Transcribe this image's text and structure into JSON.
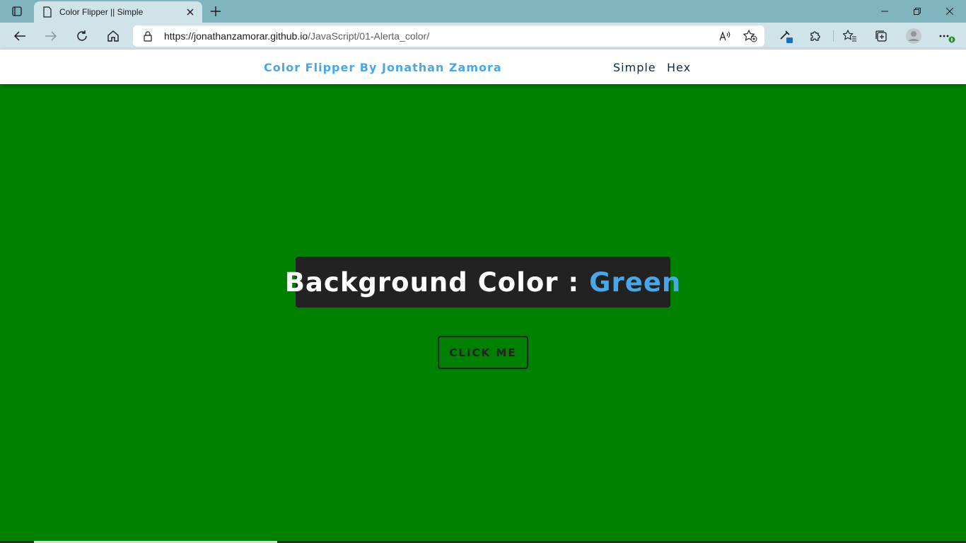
{
  "browser": {
    "tab": {
      "title": "Color Flipper || Simple"
    },
    "url": {
      "host": "https://jonathanzamorar.github.io",
      "path": "/JavaScript/01-Alerta_color/"
    }
  },
  "site": {
    "brand": "Color Flipper By Jonathan Zamora",
    "nav": [
      "Simple",
      "Hex"
    ]
  },
  "main": {
    "label": "Background Color :",
    "color_name": "Green",
    "button_label": "CLICK ME"
  },
  "colors": {
    "page_background": "#008000",
    "accent": "#49a6e9",
    "card": "#222222"
  },
  "icons": [
    "tab-actions-icon",
    "page-icon",
    "close-icon",
    "plus-icon",
    "minimize-icon",
    "restore-icon",
    "back-icon",
    "forward-icon",
    "refresh-icon",
    "home-icon",
    "lock-icon",
    "read-aloud-icon",
    "add-favorite-icon",
    "extension-pin-icon",
    "extensions-icon",
    "favorites-icon",
    "collections-icon",
    "profile-icon",
    "more-icon"
  ]
}
